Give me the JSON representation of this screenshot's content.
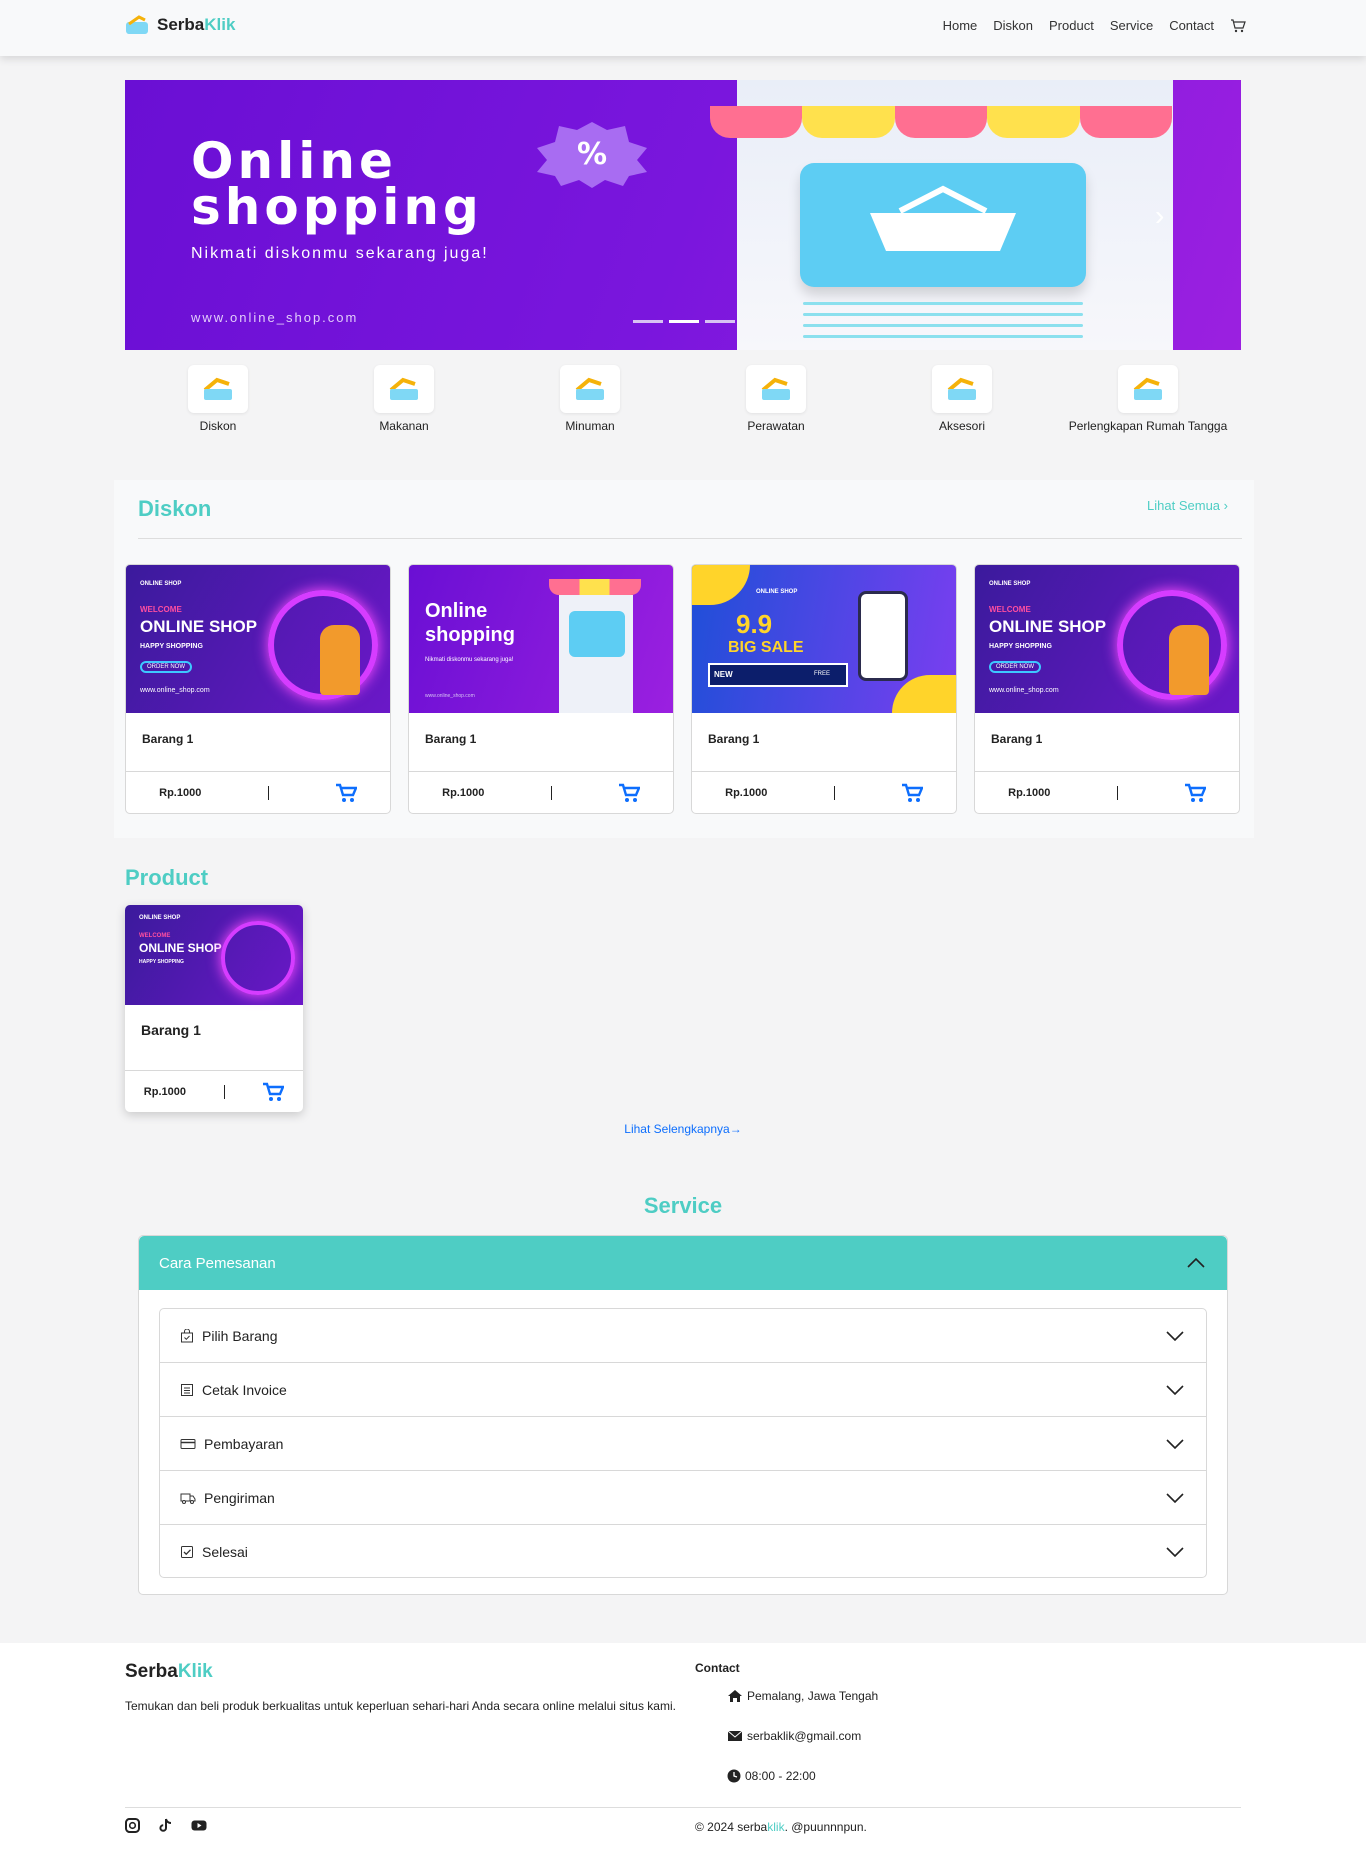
{
  "nav": {
    "brand_a": "Serba",
    "brand_b": "Klik",
    "links": [
      "Home",
      "Diskon",
      "Product",
      "Service",
      "Contact"
    ]
  },
  "hero": {
    "title_line1": "Online",
    "title_line2": "shopping",
    "subtitle": "Nikmati diskonmu sekarang juga!",
    "url": "www.online_shop.com",
    "badge": "%"
  },
  "categories": [
    {
      "label": "Diskon",
      "icon": "online-shop-logo-icon"
    },
    {
      "label": "Makanan",
      "icon": "online-shop-logo-icon"
    },
    {
      "label": "Minuman",
      "icon": "online-shop-logo-icon"
    },
    {
      "label": "Perawatan",
      "icon": "online-shop-logo-icon"
    },
    {
      "label": "Aksesori",
      "icon": "online-shop-logo-icon"
    },
    {
      "label": "Perlengkapan Rumah Tangga",
      "icon": "online-shop-logo-icon"
    }
  ],
  "diskon": {
    "title": "Diskon",
    "see_all": "Lihat Semua",
    "cards": [
      {
        "name": "Barang 1",
        "price": "Rp.1000",
        "image": "online-shop-welcome"
      },
      {
        "name": "Barang 1",
        "price": "Rp.1000",
        "image": "online-shopping"
      },
      {
        "name": "Barang 1",
        "price": "Rp.1000",
        "image": "big-sale-9.9"
      },
      {
        "name": "Barang 1",
        "price": "Rp.1000",
        "image": "online-shop-welcome"
      }
    ]
  },
  "banner_text": {
    "online_shop": "ONLINE SHOP",
    "welcome": "WELCOME",
    "happy": "HAPPY SHOPPING",
    "order": "ORDER NOW",
    "www": "www.online_shop.com",
    "os_a": "Online",
    "os_b": "shopping",
    "os_sub": "Nikmati diskonmu sekarang juga!",
    "nine": "9.9",
    "big_sale": "BIG SALE",
    "new": "NEW",
    "free": "FREE"
  },
  "product": {
    "title": "Product",
    "cards": [
      {
        "name": "Barang 1",
        "price": "Rp.1000"
      }
    ],
    "more": "Lihat Selengkapnya"
  },
  "service": {
    "title": "Service",
    "accordion_title": "Cara Pemesanan",
    "items": [
      {
        "label": "Pilih Barang",
        "icon": "bag-check-icon"
      },
      {
        "label": "Cetak Invoice",
        "icon": "receipt-icon"
      },
      {
        "label": "Pembayaran",
        "icon": "credit-card-icon"
      },
      {
        "label": "Pengiriman",
        "icon": "truck-icon"
      },
      {
        "label": "Selesai",
        "icon": "check-square-icon"
      }
    ]
  },
  "footer": {
    "brand_a": "Serba",
    "brand_b": "Klik",
    "description": "Temukan dan beli produk berkualitas untuk keperluan sehari-hari Anda secara online melalui situs kami.",
    "contact_title": "Contact",
    "address": "Pemalang, Jawa Tengah",
    "email": "serbaklik@gmail.com",
    "hours": "08:00 - 22:00",
    "copy_a": "© 2024 serba",
    "copy_b": "klik",
    "copy_c": ". @puunnnpun.",
    "social": [
      "instagram-icon",
      "tiktok-icon",
      "youtube-icon"
    ]
  },
  "colors": {
    "accent": "#4ecdc4",
    "hero": "#7a16dd",
    "link": "#0d6efd"
  }
}
